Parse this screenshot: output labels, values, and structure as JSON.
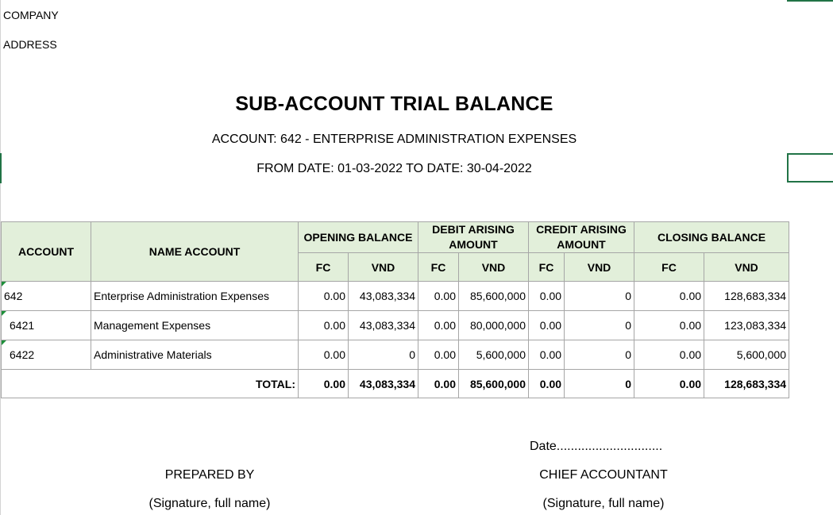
{
  "header": {
    "company": "COMPANY",
    "address": "ADDRESS"
  },
  "report": {
    "title": "SUB-ACCOUNT TRIAL BALANCE",
    "account_line": "ACCOUNT: 642 - ENTERPRISE ADMINISTRATION EXPENSES",
    "date_line": "FROM DATE: 01-03-2022 TO DATE: 30-04-2022"
  },
  "table": {
    "headers": {
      "account": "ACCOUNT",
      "name_account": "NAME ACCOUNT",
      "opening_balance": "OPENING BALANCE",
      "debit_arising": "DEBIT ARISING AMOUNT",
      "credit_arising": "CREDIT ARISING AMOUNT",
      "closing_balance": "CLOSING BALANCE",
      "fc": "FC",
      "vnd": "VND"
    },
    "rows": [
      {
        "account": "642",
        "name": "Enterprise Administration Expenses",
        "open_fc": "0.00",
        "open_vnd": "43,083,334",
        "debit_fc": "0.00",
        "debit_vnd": "85,600,000",
        "credit_fc": "0.00",
        "credit_vnd": "0",
        "close_fc": "0.00",
        "close_vnd": "128,683,334"
      },
      {
        "account": "6421",
        "name": "Management Expenses",
        "open_fc": "0.00",
        "open_vnd": "43,083,334",
        "debit_fc": "0.00",
        "debit_vnd": "80,000,000",
        "credit_fc": "0.00",
        "credit_vnd": "0",
        "close_fc": "0.00",
        "close_vnd": "123,083,334"
      },
      {
        "account": "6422",
        "name": "Administrative Materials",
        "open_fc": "0.00",
        "open_vnd": "0",
        "debit_fc": "0.00",
        "debit_vnd": "5,600,000",
        "credit_fc": "0.00",
        "credit_vnd": "0",
        "close_fc": "0.00",
        "close_vnd": "5,600,000"
      }
    ],
    "total": {
      "label": "TOTAL:",
      "open_fc": "0.00",
      "open_vnd": "43,083,334",
      "debit_fc": "0.00",
      "debit_vnd": "85,600,000",
      "credit_fc": "0.00",
      "credit_vnd": "0",
      "close_fc": "0.00",
      "close_vnd": "128,683,334"
    }
  },
  "footer": {
    "date_line": "Date..............................",
    "prepared_by": "PREPARED BY",
    "chief_accountant": "CHIEF ACCOUNTANT",
    "signature_left": "(Signature, full name)",
    "signature_right": "(Signature, full name)"
  },
  "colors": {
    "header_fill": "#e2efda",
    "selection_green": "#217346",
    "indicator_green": "#1e8f3a"
  }
}
